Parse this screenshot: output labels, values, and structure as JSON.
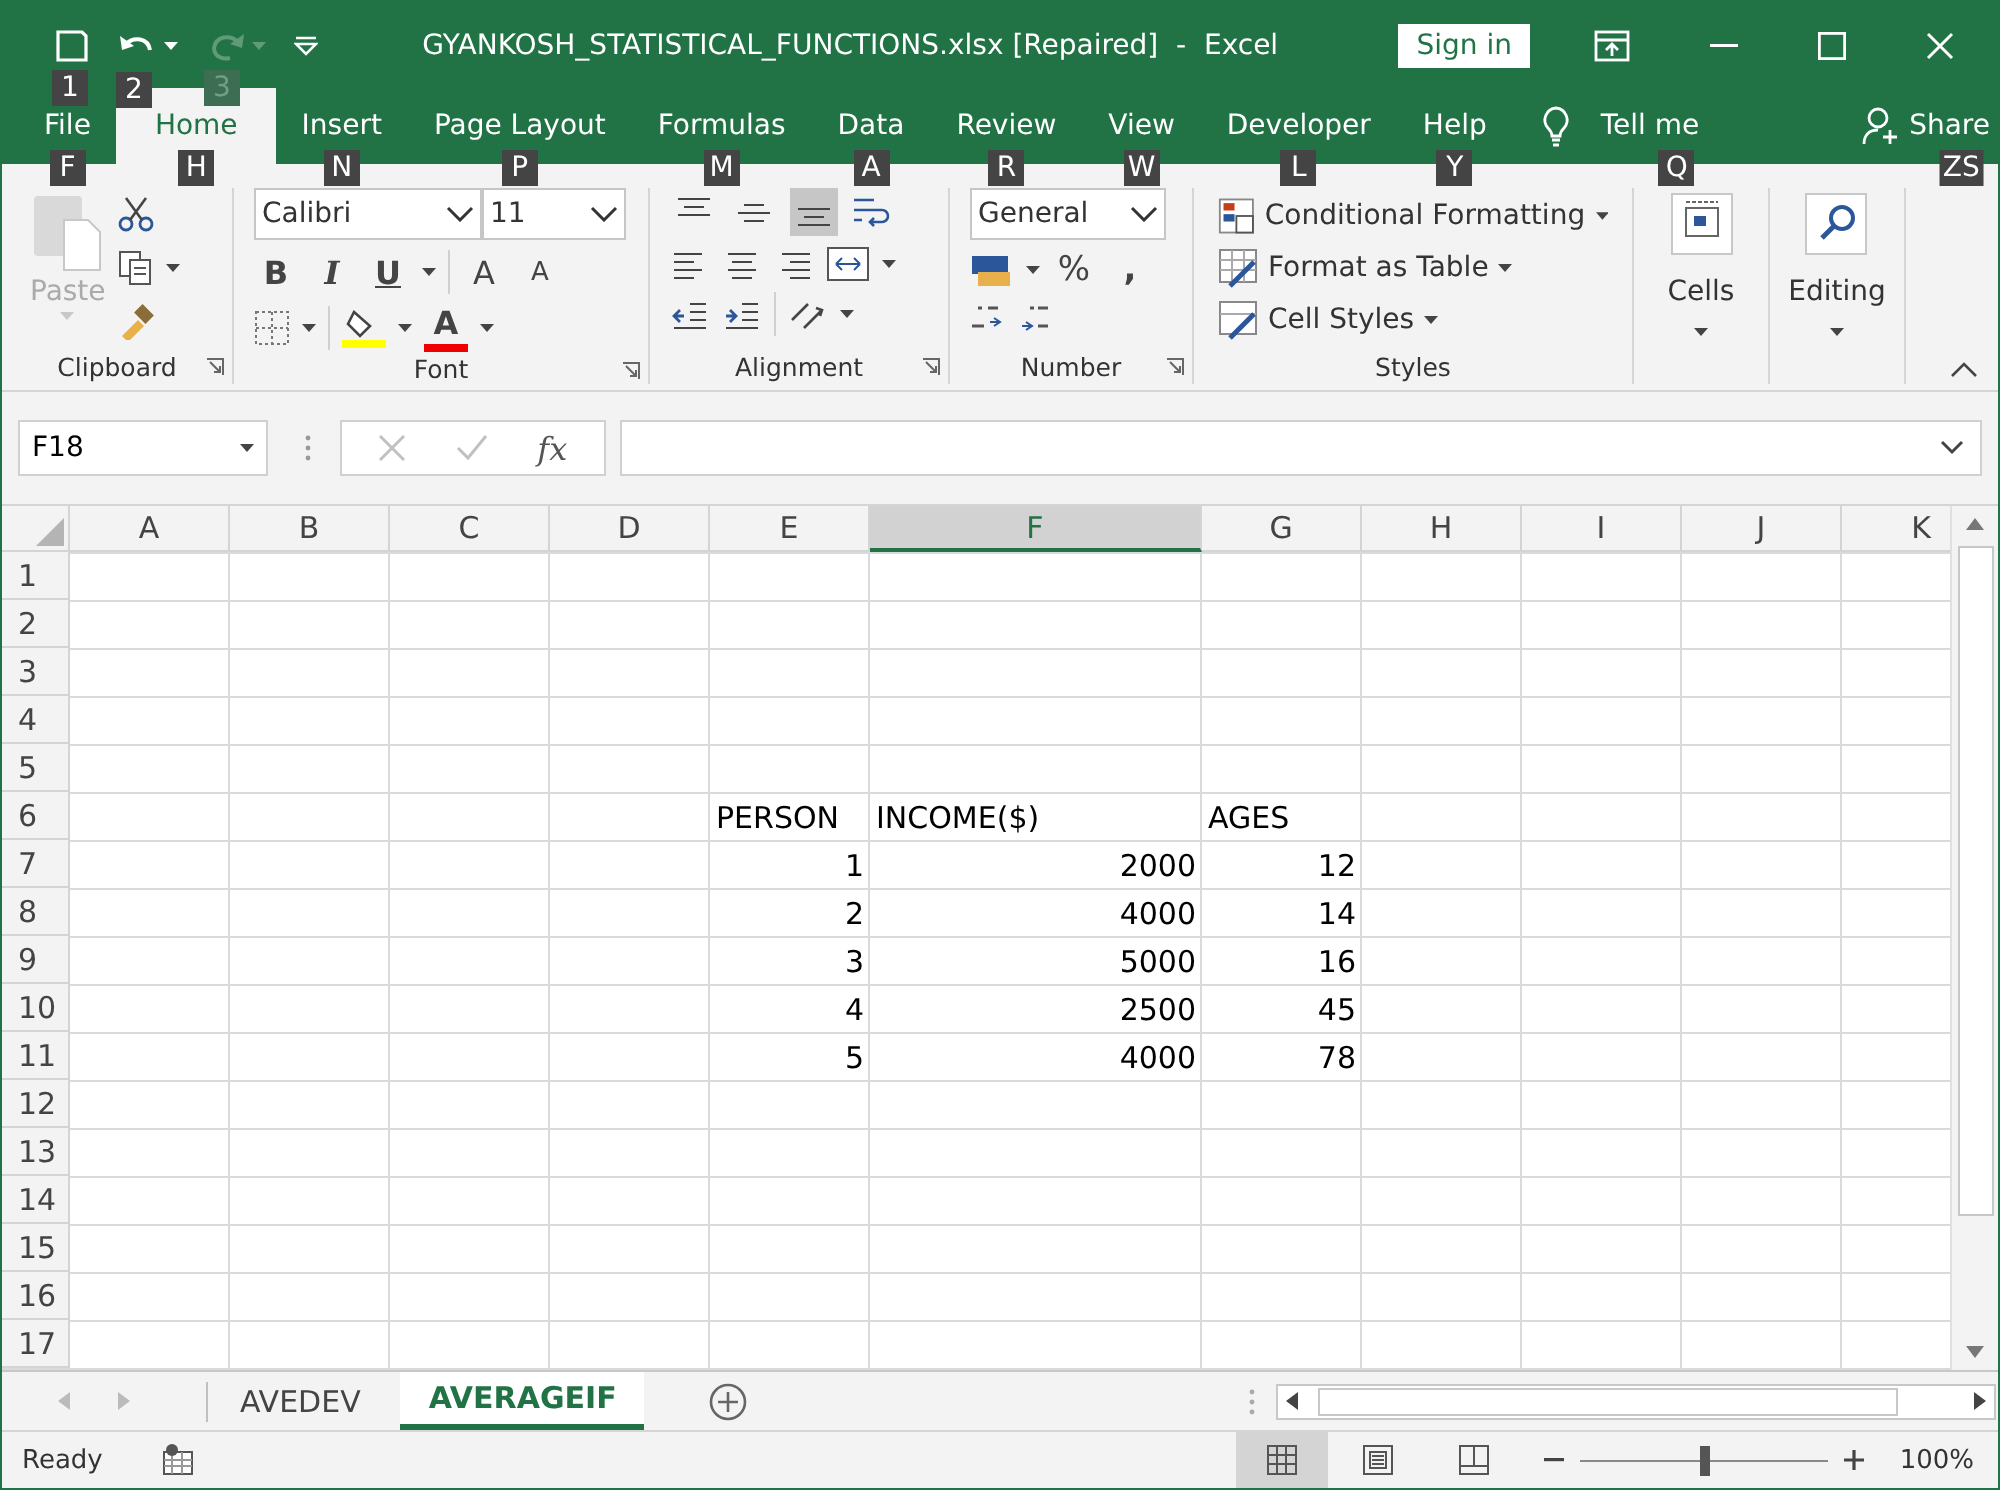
{
  "window": {
    "title": "GYANKOSH_STATISTICAL_FUNCTIONS.xlsx [Repaired]  -  Excel",
    "sign_in": "Sign in"
  },
  "quick_access": [
    {
      "kind": "save",
      "keytip": "1",
      "disabled": false
    },
    {
      "kind": "undo",
      "keytip": "2",
      "disabled": false
    },
    {
      "kind": "redo",
      "keytip": "3",
      "disabled": true
    },
    {
      "kind": "customize"
    }
  ],
  "tabs": [
    {
      "label": "File",
      "keytip": "F",
      "selected": false
    },
    {
      "label": "Home",
      "keytip": "H",
      "selected": true
    },
    {
      "label": "Insert",
      "keytip": "N",
      "selected": false
    },
    {
      "label": "Page Layout",
      "keytip": "P",
      "selected": false
    },
    {
      "label": "Formulas",
      "keytip": "M",
      "selected": false
    },
    {
      "label": "Data",
      "keytip": "A",
      "selected": false
    },
    {
      "label": "Review",
      "keytip": "R",
      "selected": false
    },
    {
      "label": "View",
      "keytip": "W",
      "selected": false
    },
    {
      "label": "Developer",
      "keytip": "L",
      "selected": false
    },
    {
      "label": "Help",
      "keytip": "Y",
      "selected": false
    }
  ],
  "tell_me": {
    "label": "Tell me",
    "keytip": "Q"
  },
  "share": {
    "label": "Share",
    "keytip": "ZS"
  },
  "ribbon": {
    "clipboard": {
      "label": "Clipboard",
      "paste": "Paste",
      "paste_disabled": true
    },
    "font": {
      "label": "Font",
      "font_name": "Calibri",
      "font_size": "11",
      "bold": "B",
      "italic": "I",
      "underline": "U",
      "grow": "A",
      "shrink": "A",
      "font_color": "A"
    },
    "alignment": {
      "label": "Alignment",
      "vertical": [
        {
          "kind": "top",
          "selected": false
        },
        {
          "kind": "middle",
          "selected": false
        },
        {
          "kind": "bottom",
          "selected": true
        }
      ]
    },
    "number": {
      "label": "Number",
      "format": "General",
      "percent": "%",
      "comma": ","
    },
    "styles": {
      "label": "Styles",
      "items": [
        "Conditional Formatting",
        "Format as Table",
        "Cell Styles"
      ]
    },
    "cells": {
      "label": "Cells"
    },
    "editing": {
      "label": "Editing"
    }
  },
  "formula_bar": {
    "name_box": "F18",
    "fx": "fx"
  },
  "sheet": {
    "columns": [
      {
        "label": "A",
        "selected": false
      },
      {
        "label": "B",
        "selected": false
      },
      {
        "label": "C",
        "selected": false
      },
      {
        "label": "D",
        "selected": false
      },
      {
        "label": "E",
        "selected": false
      },
      {
        "label": "F",
        "selected": true
      },
      {
        "label": "G",
        "selected": false
      },
      {
        "label": "H",
        "selected": false
      },
      {
        "label": "I",
        "selected": false
      },
      {
        "label": "J",
        "selected": false
      },
      {
        "label": "K",
        "selected": false
      }
    ],
    "rows": [
      {
        "header": "1"
      },
      {
        "header": "2"
      },
      {
        "header": "3"
      },
      {
        "header": "4"
      },
      {
        "header": "5"
      },
      {
        "header": "6",
        "cells": [
          null,
          null,
          null,
          null,
          {
            "text": "PERSON",
            "kind": "text"
          },
          {
            "text": "INCOME($)",
            "kind": "text"
          },
          {
            "text": "AGES",
            "kind": "text"
          }
        ]
      },
      {
        "header": "7",
        "cells": [
          null,
          null,
          null,
          null,
          {
            "text": "1",
            "kind": "number"
          },
          {
            "text": "2000",
            "kind": "number"
          },
          {
            "text": "12",
            "kind": "number"
          }
        ]
      },
      {
        "header": "8",
        "cells": [
          null,
          null,
          null,
          null,
          {
            "text": "2",
            "kind": "number"
          },
          {
            "text": "4000",
            "kind": "number"
          },
          {
            "text": "14",
            "kind": "number"
          }
        ]
      },
      {
        "header": "9",
        "cells": [
          null,
          null,
          null,
          null,
          {
            "text": "3",
            "kind": "number"
          },
          {
            "text": "5000",
            "kind": "number"
          },
          {
            "text": "16",
            "kind": "number"
          }
        ]
      },
      {
        "header": "10",
        "cells": [
          null,
          null,
          null,
          null,
          {
            "text": "4",
            "kind": "number"
          },
          {
            "text": "2500",
            "kind": "number"
          },
          {
            "text": "45",
            "kind": "number"
          }
        ]
      },
      {
        "header": "11",
        "cells": [
          null,
          null,
          null,
          null,
          {
            "text": "5",
            "kind": "number"
          },
          {
            "text": "4000",
            "kind": "number"
          },
          {
            "text": "78",
            "kind": "number"
          }
        ]
      },
      {
        "header": "12"
      },
      {
        "header": "13"
      },
      {
        "header": "14"
      },
      {
        "header": "15"
      },
      {
        "header": "16"
      },
      {
        "header": "17"
      }
    ]
  },
  "sheet_tabs": [
    {
      "label": "AVEDEV",
      "selected": false
    },
    {
      "label": "AVERAGEIF",
      "selected": true
    }
  ],
  "status_bar": {
    "status": "Ready",
    "views": [
      {
        "kind": "normal",
        "selected": true
      },
      {
        "kind": "page_layout",
        "selected": false
      },
      {
        "kind": "page_break",
        "selected": false
      }
    ],
    "zoom": {
      "level": 0.5,
      "reading": "100%"
    }
  }
}
